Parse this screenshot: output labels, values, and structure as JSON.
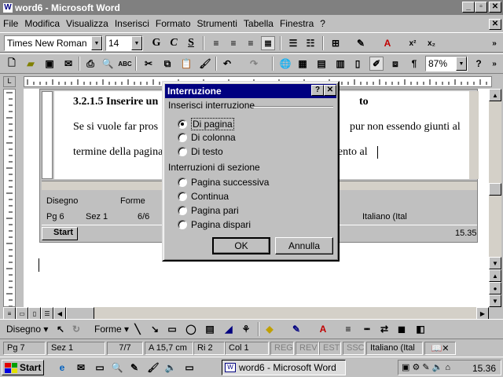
{
  "window": {
    "title": "word6 - Microsoft Word"
  },
  "menu": [
    "File",
    "Modifica",
    "Visualizza",
    "Inserisci",
    "Formato",
    "Strumenti",
    "Tabella",
    "Finestra",
    "?"
  ],
  "format_bar": {
    "font": "Times New Roman",
    "size": "14",
    "bold": "G",
    "italic": "C",
    "underline": "S"
  },
  "standard_bar": {
    "zoom": "87%"
  },
  "document": {
    "heading": "3.2.1.5 Inserire un",
    "heading_tail": "to",
    "line1_a": "Se si vuole far pros",
    "line1_b": "pur non essendo giunti al",
    "line2_a": "termine della pagina",
    "line2_b": "mento al"
  },
  "inner_drawbar": {
    "disegno": "Disegno",
    "forme": "Forme"
  },
  "inner_status": {
    "pg": "Pg 6",
    "sez": "Sez 1",
    "pages": "6/6",
    "lang": "Italiano (Ital"
  },
  "inner_taskbar": {
    "start": "Start",
    "clock": "15.35"
  },
  "dialog": {
    "title": "Interruzione",
    "group1": "Inserisci interruzione",
    "opt_pagina": "Di pagina",
    "opt_colonna": "Di colonna",
    "opt_testo": "Di testo",
    "group2": "Interruzioni di sezione",
    "opt_successiva": "Pagina successiva",
    "opt_continua": "Continua",
    "opt_pari": "Pagina pari",
    "opt_dispari": "Pagina dispari",
    "ok": "OK",
    "cancel": "Annulla"
  },
  "drawbar": {
    "disegno": "Disegno",
    "forme": "Forme"
  },
  "status": {
    "pg": "Pg 7",
    "sez": "Sez 1",
    "pages": "7/7",
    "pos": "A 15,7 cm",
    "ri": "Ri 2",
    "col": "Col 1",
    "reg": "REG",
    "rev": "REV",
    "est": "EST",
    "ssc": "SSC",
    "lang": "Italiano (Ital"
  },
  "taskbar": {
    "start": "Start",
    "task": "word6 - Microsoft Word",
    "clock": "15.36"
  },
  "colors": {
    "title_inactive": "#808080",
    "dialog_title": "#000080",
    "face": "#c0c0c0"
  }
}
